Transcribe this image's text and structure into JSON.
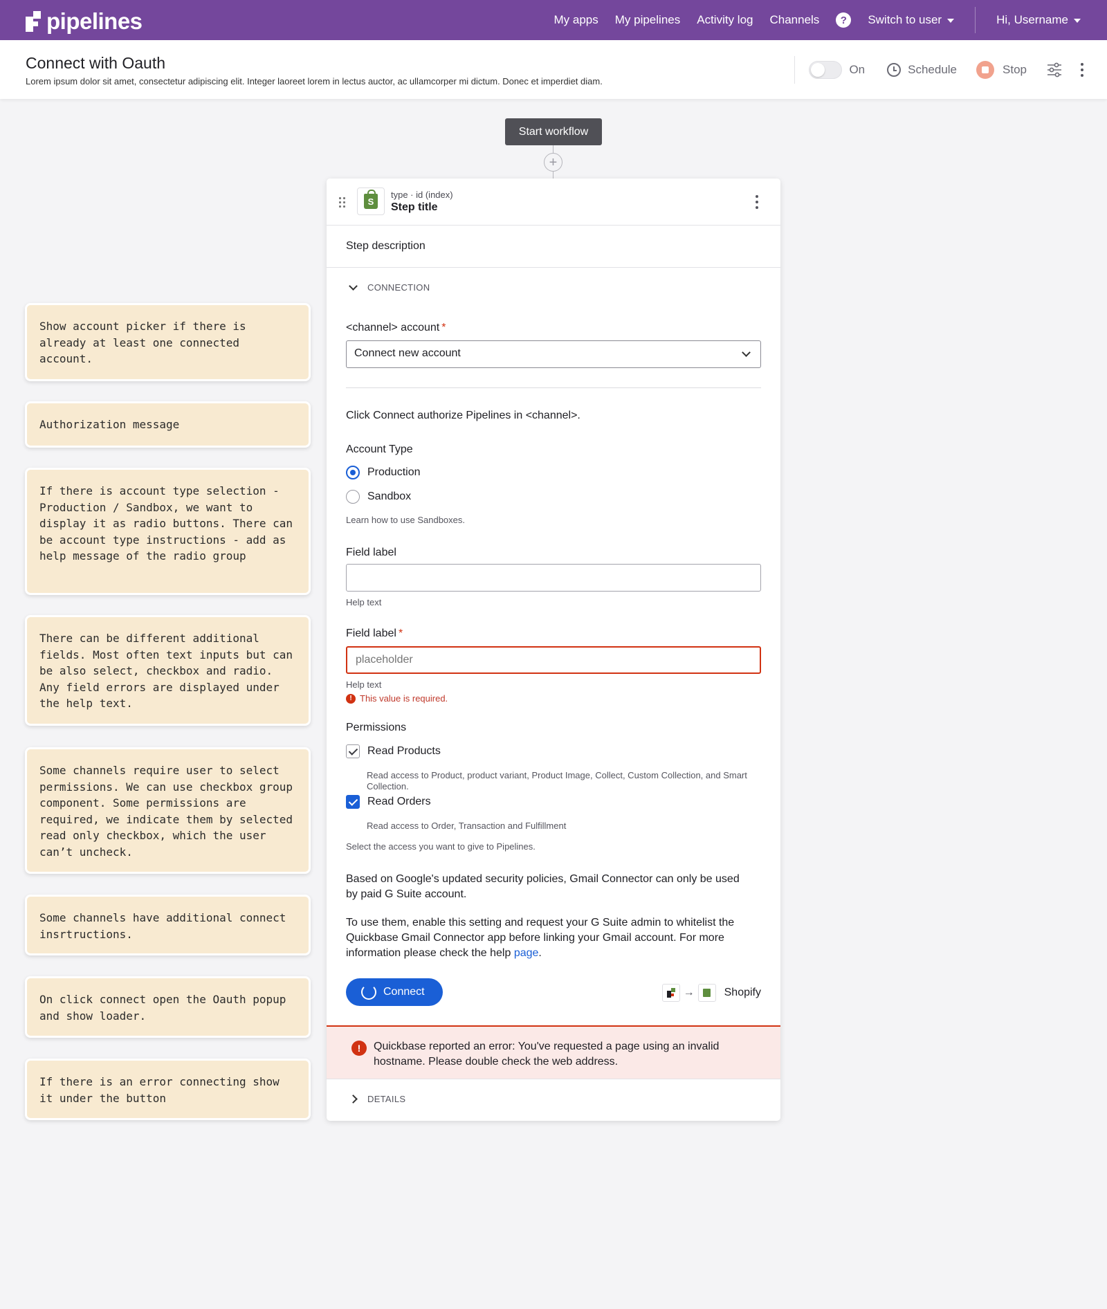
{
  "nav": {
    "logo": "pipelines",
    "items": [
      "My apps",
      "My pipelines",
      "Activity log",
      "Channels"
    ],
    "help": "?",
    "switch_user": "Switch to user",
    "greeting": "Hi, Username"
  },
  "header": {
    "title": "Connect with Oauth",
    "subtitle": "Lorem ipsum dolor sit amet, consectetur adipiscing elit. Integer laoreet lorem in lectus auctor, ac ullamcorper mi dictum. Donec et imperdiet diam.",
    "toggle_label": "On",
    "schedule_label": "Schedule",
    "stop_label": "Stop"
  },
  "workflow": {
    "start_label": "Start workflow",
    "add": "+"
  },
  "notes": [
    "Show account picker if there is already at least one connected account.",
    "Authorization message",
    "If there is account type selection - Production / Sandbox, we want to display it as radio buttons. There can be account type instructions - add as help message of the radio group",
    "There can be different additional fields. Most often text inputs but can be also select, checkbox and radio. Any field errors are displayed under the help text.",
    "Some channels require user to select permissions. We can use checkbox group component. Some permissions are required, we indicate them by selected read only checkbox, which the user can’t uncheck.",
    "Some channels have additional connect insrtructions.",
    "On click connect open the Oauth popup and show loader.",
    "If there is an error connecting show it under the button"
  ],
  "step": {
    "meta": "type · id (index)",
    "title": "Step title",
    "description": "Step description",
    "section_label": "CONNECTION",
    "account_label": "<channel> account",
    "required_mark": "*",
    "account_value": "Connect new account",
    "auth_message": "Click Connect authorize Pipelines in <channel>.",
    "account_type_label": "Account Type",
    "account_types": [
      "Production",
      "Sandbox"
    ],
    "selected_account_type": "Production",
    "account_type_help": "Learn how to use Sandboxes.",
    "field1": {
      "label": "Field label",
      "value": "",
      "help": "Help text"
    },
    "field2": {
      "label": "Field label",
      "placeholder": "placeholder",
      "help": "Help text",
      "error": "This value is required."
    },
    "permissions_label": "Permissions",
    "permissions": [
      {
        "name": "Read Products",
        "desc": "Read access to Product, product variant, Product Image, Collect, Custom Collection, and Smart Collection.",
        "checked": true,
        "readonly": true
      },
      {
        "name": "Read Orders",
        "desc": "Read access to Order, Transaction and Fulfillment",
        "checked": true,
        "readonly": false
      }
    ],
    "permissions_help": "Select the access you want to give to Pipelines.",
    "instructions_1": "Based on Google's updated security policies, Gmail Connector can only be used by paid G Suite account.",
    "instructions_2": "To use them, enable this setting and request your G Suite admin to whitelist the Quickbase Gmail Connector app before linking your Gmail account. For more information please check the help",
    "instructions_link": "page",
    "instructions_end": ".",
    "connect_label": "Connect",
    "arrow": "→",
    "target_channel": "Shopify",
    "error_message": "Quickbase reported an error: You've requested a page using an invalid hostname. Please double check the web address.",
    "details_label": "DETAILS"
  },
  "colors": {
    "brand": "#74479c",
    "primary": "#1a5fd6",
    "error": "#d13212",
    "note_bg": "#f8ead1"
  }
}
